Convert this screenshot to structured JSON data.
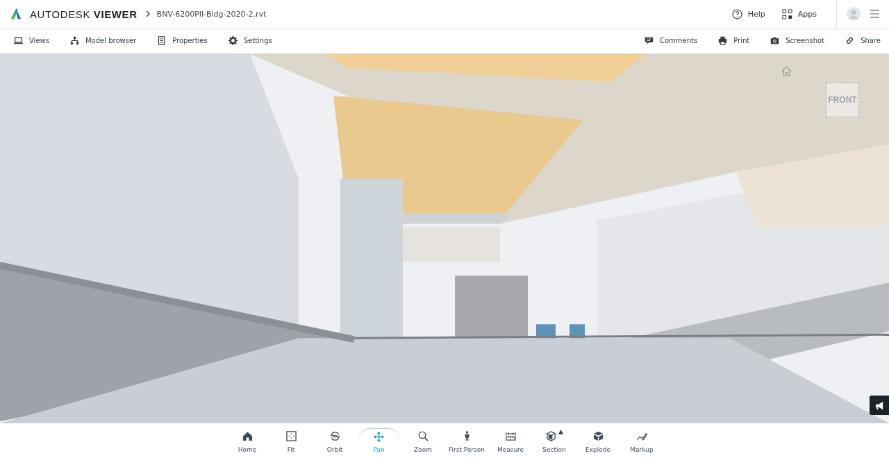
{
  "header": {
    "brand": {
      "light": "AUTODESK",
      "bold": "VIEWER"
    },
    "file_name": "BNV-6200PII-Bldg-2020-2.rvt",
    "links": [
      {
        "label": "Help",
        "kind": "help"
      },
      {
        "label": "Apps",
        "kind": "apps"
      }
    ]
  },
  "toolbar": {
    "left": [
      {
        "label": "Views",
        "kind": "views"
      },
      {
        "label": "Model browser",
        "kind": "tree"
      },
      {
        "label": "Properties",
        "kind": "doc"
      },
      {
        "label": "Settings",
        "kind": "gear"
      }
    ],
    "right": [
      {
        "label": "Comments",
        "kind": "comment"
      },
      {
        "label": "Print",
        "kind": "print"
      },
      {
        "label": "Screenshot",
        "kind": "camera"
      },
      {
        "label": "Share",
        "kind": "link"
      }
    ]
  },
  "viewport": {
    "viewcube_face": "FRONT"
  },
  "bottom_toolbar": [
    {
      "label": "Home",
      "kind": "home",
      "selected": false
    },
    {
      "label": "Fit",
      "kind": "fit",
      "selected": false
    },
    {
      "label": "Orbit",
      "kind": "orbit",
      "selected": false
    },
    {
      "label": "Pan",
      "kind": "pan",
      "selected": true
    },
    {
      "label": "Zoom",
      "kind": "zoom",
      "selected": false
    },
    {
      "label": "First Person",
      "kind": "person",
      "selected": false
    },
    {
      "label": "Measure",
      "kind": "measure",
      "selected": false
    },
    {
      "label": "Section",
      "kind": "section",
      "selected": false
    },
    {
      "label": "Explode",
      "kind": "explode",
      "selected": false
    },
    {
      "label": "Markup",
      "kind": "markup",
      "selected": false
    }
  ]
}
